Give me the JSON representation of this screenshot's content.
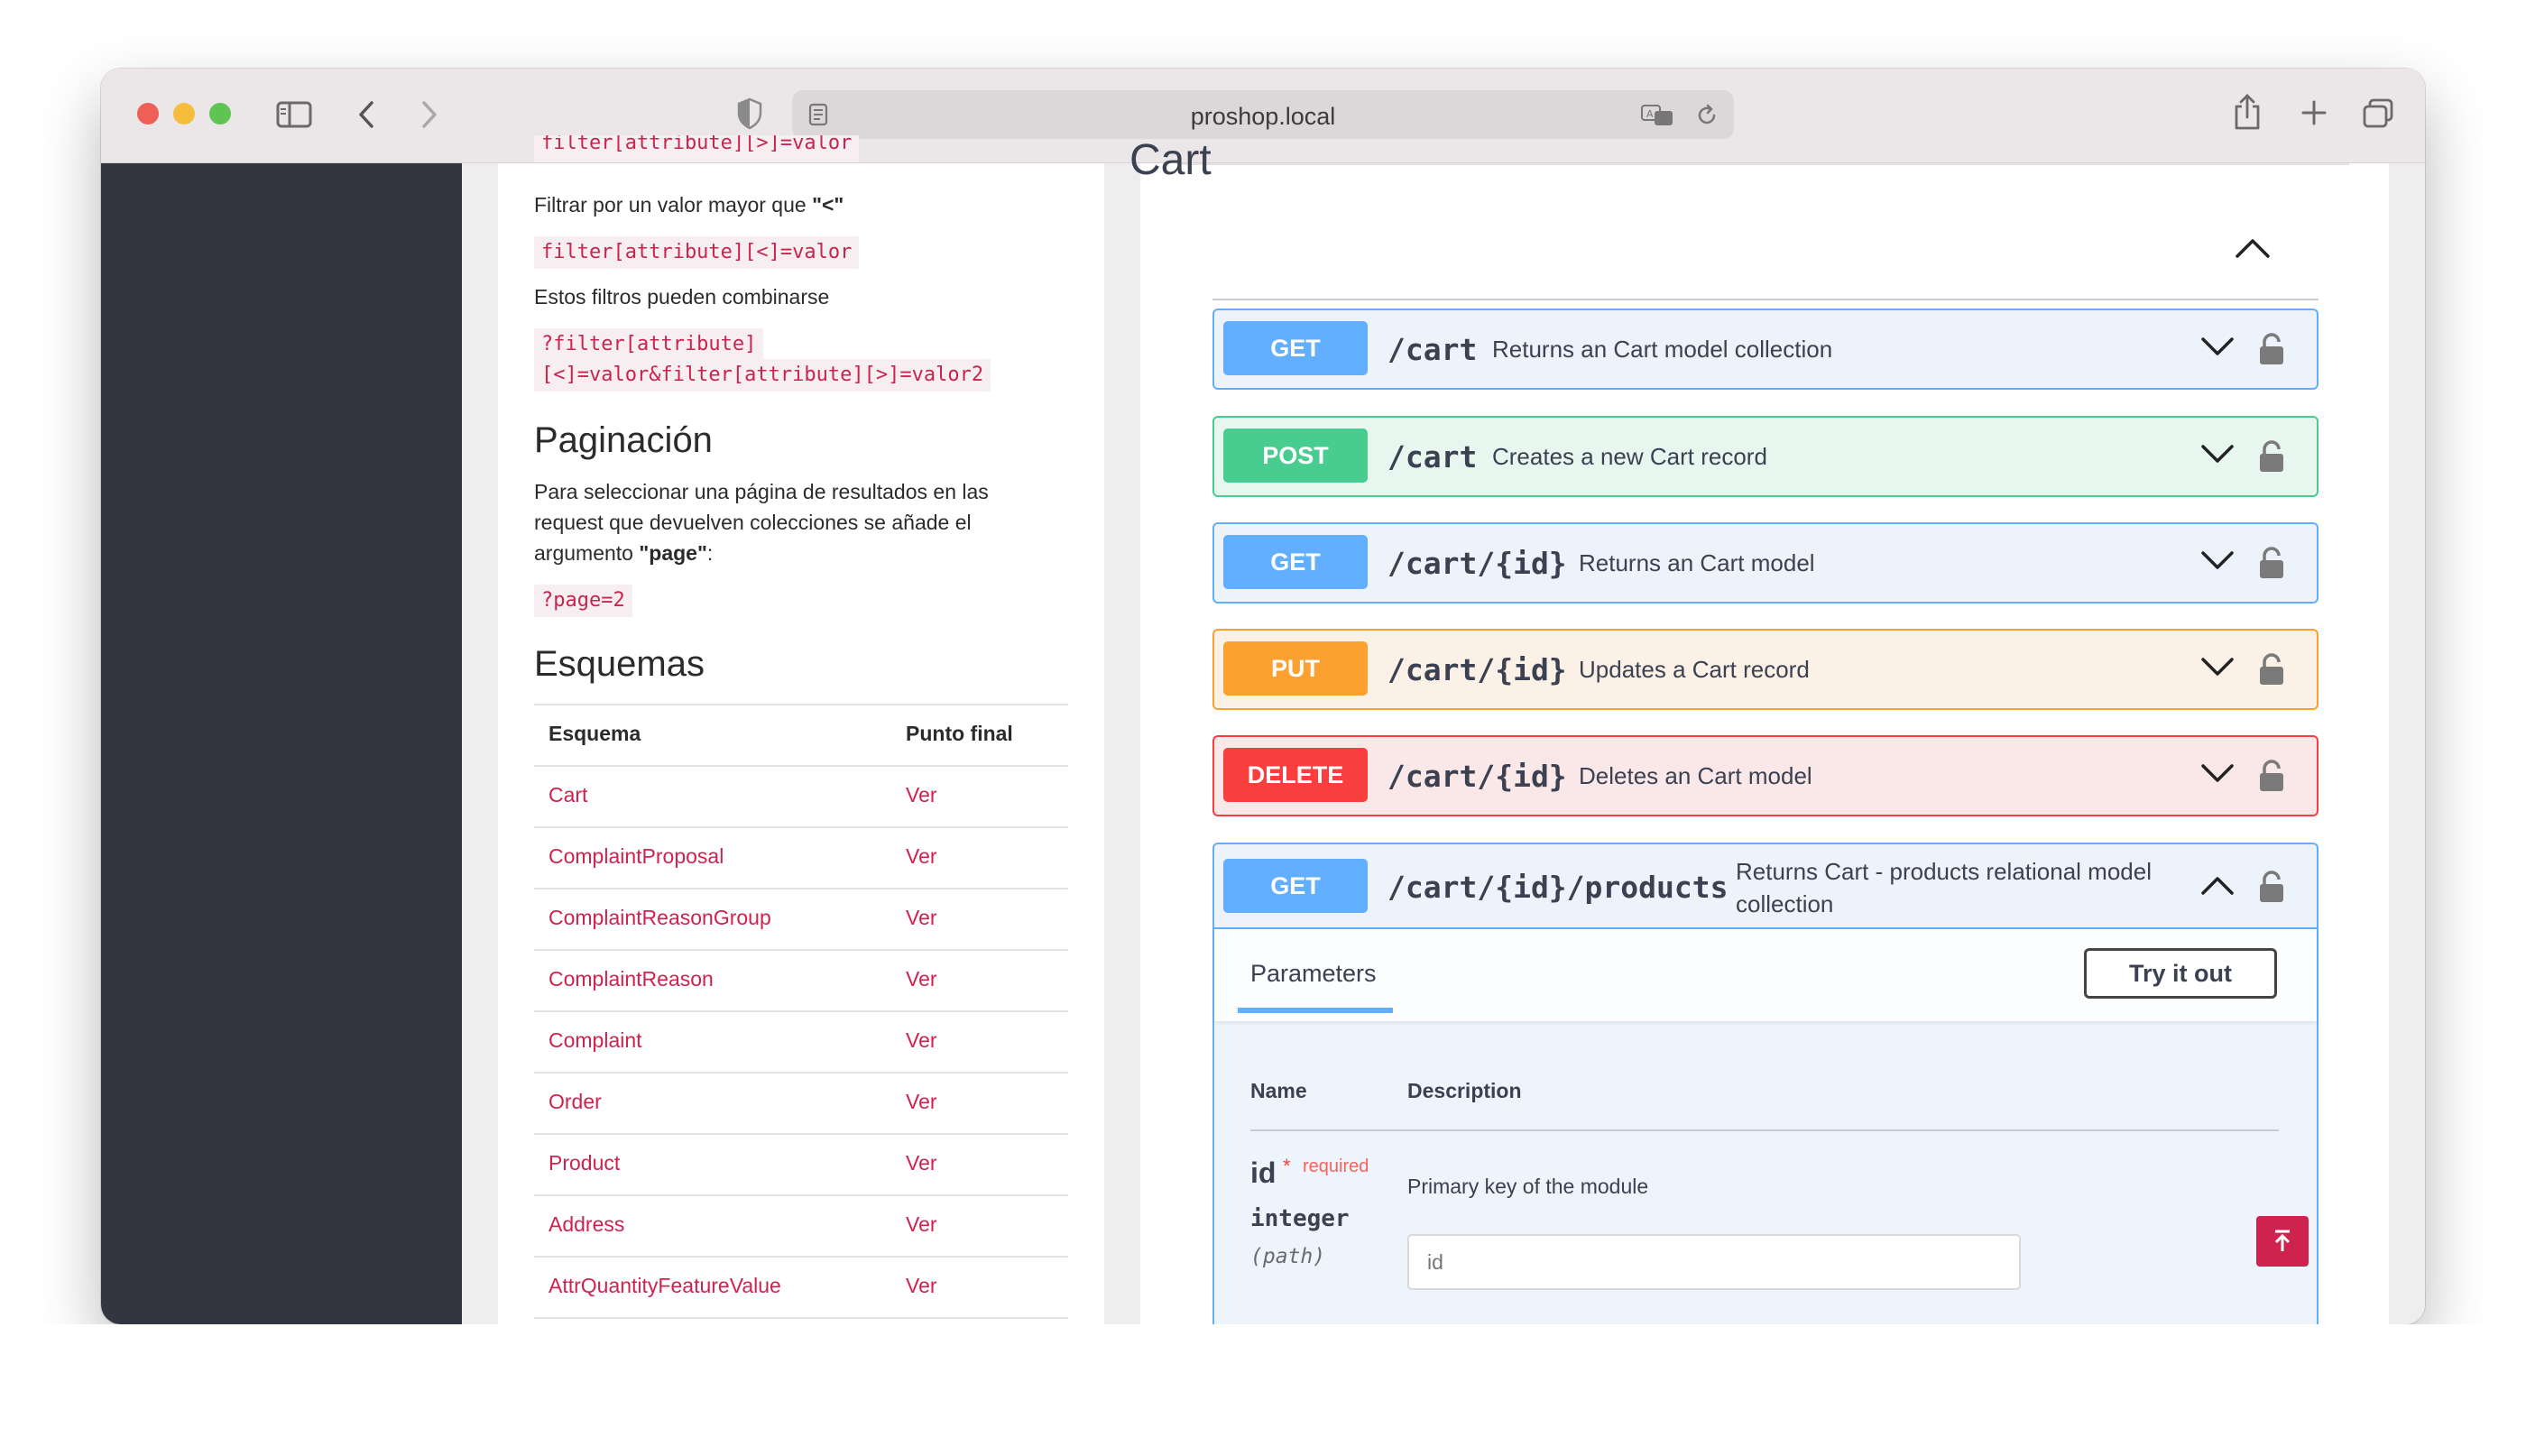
{
  "browser": {
    "url": "proshop.local"
  },
  "docs": {
    "clipped_code": "filter[attribute][>]=valor",
    "filter_lt_text": "Filtrar por un valor mayor que ",
    "filter_lt_symbol": "\"<\"",
    "filter_lt_code": "filter[attribute][<]=valor",
    "combine_text": "Estos filtros pueden combinarse",
    "combo_code_line1": "?filter[attribute]",
    "combo_code_line2": "[<]=valor&filter[attribute][>]=valor2",
    "pagination_title": "Paginación",
    "pagination_line1": "Para seleccionar una página de resultados en las",
    "pagination_line2": "request que devuelven colecciones se añade el",
    "pagination_line3_prefix": "argumento ",
    "pagination_line3_bold": "\"page\"",
    "pagination_line3_suffix": ":",
    "pagination_code": "?page=2",
    "schemas_title": "Esquemas",
    "schema_col_header": "Esquema",
    "endpoint_col_header": "Punto final",
    "schemas": [
      {
        "name": "Cart",
        "link": "Ver"
      },
      {
        "name": "ComplaintProposal",
        "link": "Ver"
      },
      {
        "name": "ComplaintReasonGroup",
        "link": "Ver"
      },
      {
        "name": "ComplaintReason",
        "link": "Ver"
      },
      {
        "name": "Complaint",
        "link": "Ver"
      },
      {
        "name": "Order",
        "link": "Ver"
      },
      {
        "name": "Product",
        "link": "Ver"
      },
      {
        "name": "Address",
        "link": "Ver"
      },
      {
        "name": "AttrQuantityFeatureValue",
        "link": "Ver"
      }
    ]
  },
  "api": {
    "section_title": "Cart",
    "operations": [
      {
        "method": "GET",
        "path": "/cart",
        "summary": "Returns an Cart model collection"
      },
      {
        "method": "POST",
        "path": "/cart",
        "summary": "Creates a new Cart record"
      },
      {
        "method": "GET",
        "path": "/cart/{id}",
        "summary": "Returns an Cart model"
      },
      {
        "method": "PUT",
        "path": "/cart/{id}",
        "summary": "Updates a Cart record"
      },
      {
        "method": "DELETE",
        "path": "/cart/{id}",
        "summary": "Deletes an Cart model"
      },
      {
        "method": "GET",
        "path": "/cart/{id}/products",
        "summary_line1": "Returns Cart - products relational model",
        "summary_line2": "collection"
      }
    ],
    "parameters_tab": "Parameters",
    "try_button": "Try it out",
    "param_header_name": "Name",
    "param_header_desc": "Description",
    "param": {
      "name": "id",
      "required_mark": "*",
      "required_label": "required",
      "type": "integer",
      "location": "(path)",
      "description": "Primary key of the module",
      "placeholder": "id"
    }
  },
  "colors": {
    "get": "#61affe",
    "post": "#49cc90",
    "put": "#fca130",
    "delete": "#f93e3e",
    "link": "#d0224f"
  }
}
